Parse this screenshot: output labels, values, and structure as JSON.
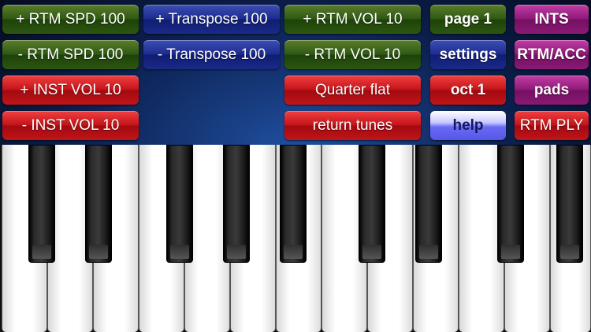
{
  "buttons": {
    "rtm_spd_up": "+ RTM SPD 100",
    "rtm_spd_down": "- RTM SPD 100",
    "inst_vol_up": "+ INST VOL 10",
    "inst_vol_down": "- INST VOL 10",
    "transpose_up": "+ Transpose 100",
    "transpose_down": "- Transpose 100",
    "rtm_vol_up": "+ RTM VOL 10",
    "rtm_vol_down": "- RTM VOL 10",
    "quarter_flat": "Quarter flat",
    "return_tunes": "return tunes",
    "page": "page 1",
    "settings": "settings",
    "oct": "oct 1",
    "help": "help",
    "ints": "INTS",
    "rtm_acc": "RTM/ACC",
    "pads": "pads",
    "rtm_ply": "RTM PLY"
  },
  "colors": {
    "green": "#2f5a14",
    "blue": "#1c2b8e",
    "red": "#c4141a",
    "purple": "#8e1a78",
    "help": "#6a6af6"
  }
}
